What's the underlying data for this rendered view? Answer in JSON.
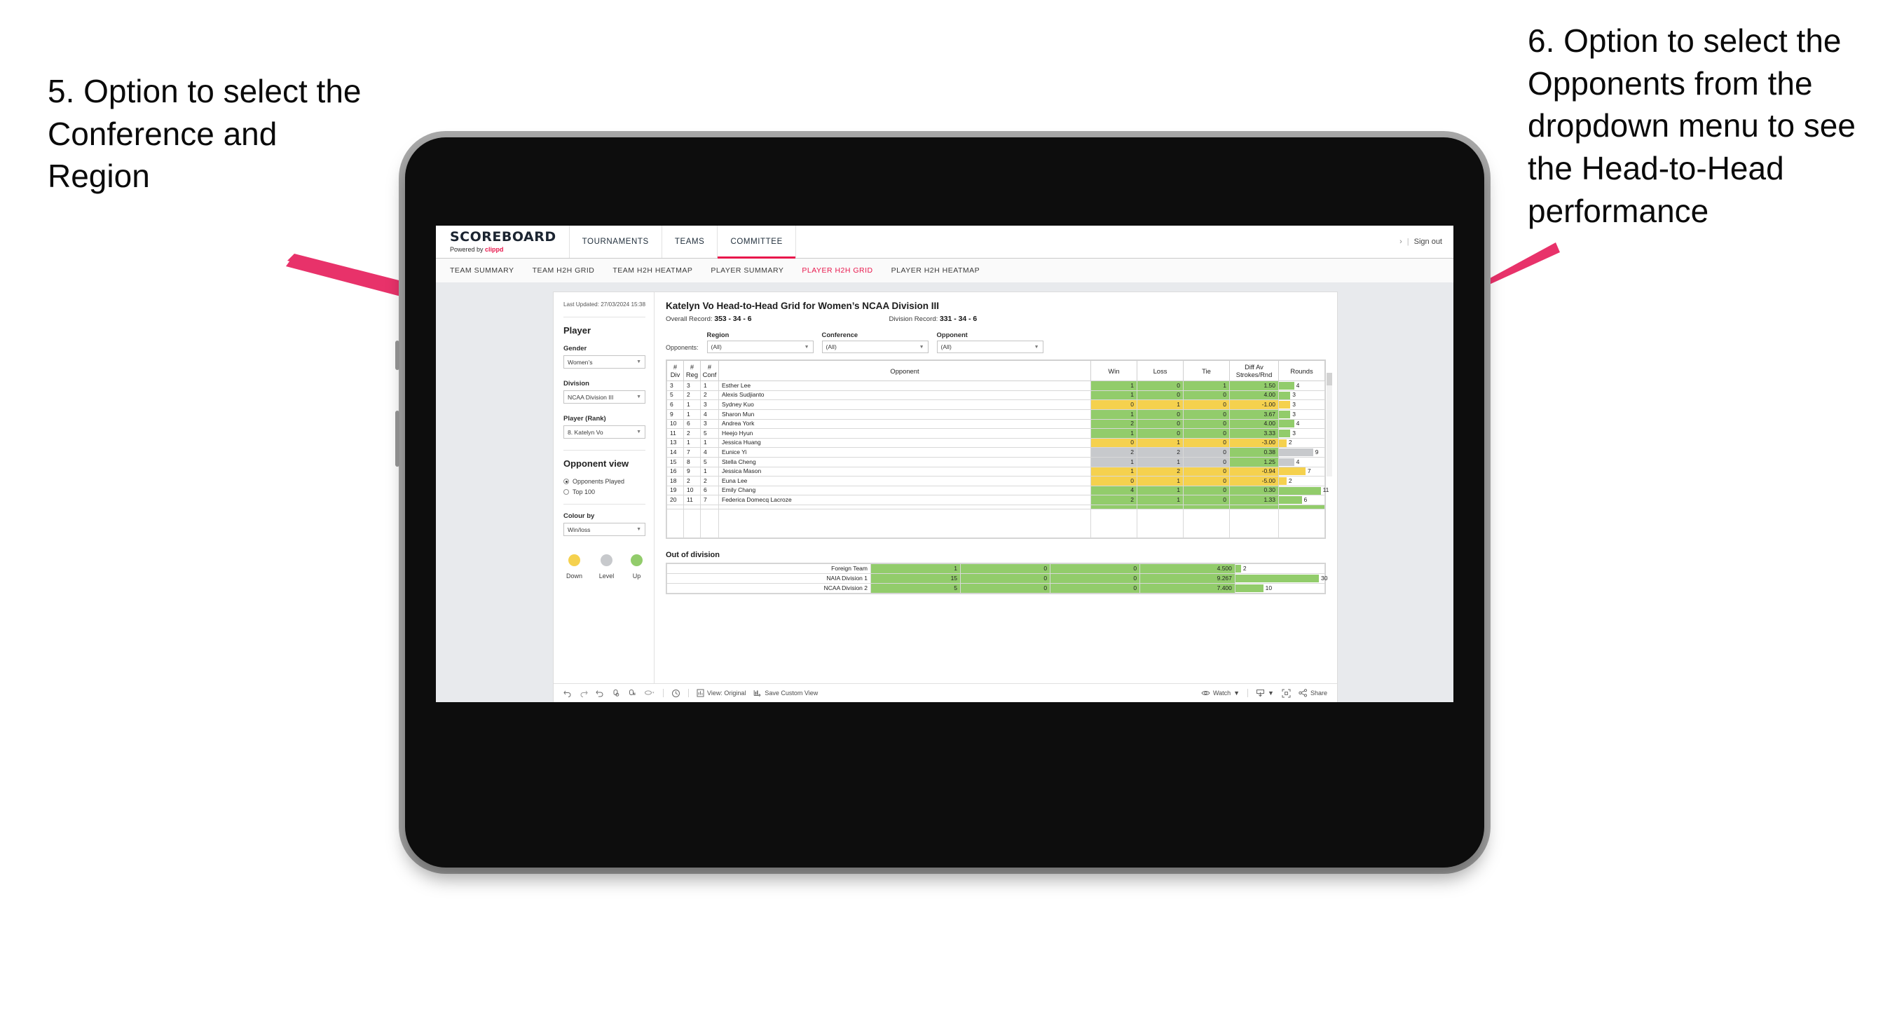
{
  "annotations": {
    "left": "5. Option to select the Conference and Region",
    "right": "6. Option to select the Opponents from the dropdown menu to see the Head-to-Head performance"
  },
  "colors": {
    "accent": "#e8174c",
    "up_green": "#92cc6b",
    "down_yellow": "#f5d14e",
    "level_grey": "#c7c9cc",
    "arrow": "#e8326a"
  },
  "app": {
    "brand": {
      "name": "SCOREBOARD",
      "powered_prefix": "Powered by",
      "powered_brand": "clippd"
    },
    "top_nav": [
      {
        "label": "TOURNAMENTS",
        "active": false
      },
      {
        "label": "TEAMS",
        "active": false
      },
      {
        "label": "COMMITTEE",
        "active": true
      }
    ],
    "top_right": {
      "chevron": "›",
      "divider": "|",
      "sign_out": "Sign out"
    },
    "sub_nav": [
      {
        "label": "TEAM SUMMARY",
        "active": false
      },
      {
        "label": "TEAM H2H GRID",
        "active": false
      },
      {
        "label": "TEAM H2H HEATMAP",
        "active": false
      },
      {
        "label": "PLAYER SUMMARY",
        "active": false
      },
      {
        "label": "PLAYER H2H GRID",
        "active": true
      },
      {
        "label": "PLAYER H2H HEATMAP",
        "active": false
      }
    ]
  },
  "sidebar": {
    "last_updated": "Last Updated: 27/03/2024 15:38",
    "section_player": "Player",
    "gender": {
      "label": "Gender",
      "value": "Women’s"
    },
    "division": {
      "label": "Division",
      "value": "NCAA Division III"
    },
    "player_rank": {
      "label": "Player (Rank)",
      "value": "8. Katelyn Vo"
    },
    "opponent_view": {
      "title": "Opponent view",
      "options": [
        {
          "label": "Opponents Played",
          "selected": true
        },
        {
          "label": "Top 100",
          "selected": false
        }
      ]
    },
    "colour_by": {
      "label": "Colour by",
      "value": "Win/loss"
    },
    "legend": [
      {
        "caption": "Down",
        "color": "#f5d14e"
      },
      {
        "caption": "Level",
        "color": "#c7c9cc"
      },
      {
        "caption": "Up",
        "color": "#92cc6b"
      }
    ]
  },
  "main": {
    "title": "Katelyn Vo Head-to-Head Grid for Women’s NCAA Division III",
    "overall_record": {
      "label": "Overall Record:",
      "value": "353 -  34 - 6"
    },
    "division_record": {
      "label": "Division Record:",
      "value": "331 -  34 - 6"
    },
    "filters_lead": "Opponents:",
    "filters": [
      {
        "label": "Region",
        "value": "(All)"
      },
      {
        "label": "Conference",
        "value": "(All)"
      },
      {
        "label": "Opponent",
        "value": "(All)"
      }
    ],
    "table": {
      "headers": [
        "# Div",
        "# Reg",
        "# Conf",
        "Opponent",
        "Win",
        "Loss",
        "Tie",
        "Diff Av Strokes/Rnd",
        "Rounds"
      ],
      "header_lines": [
        [
          "#",
          "Div"
        ],
        [
          "#",
          "Reg"
        ],
        [
          "#",
          "Conf"
        ],
        [
          "Opponent"
        ],
        [
          "Win"
        ],
        [
          "Loss"
        ],
        [
          "Tie"
        ],
        [
          "Diff Av",
          "Strokes/Rnd"
        ],
        [
          "Rounds"
        ]
      ],
      "rows": [
        {
          "div": "3",
          "reg": "3",
          "conf": "1",
          "opponent": "Esther Lee",
          "win": "1",
          "loss": "0",
          "tie": "1",
          "diff": "1.50",
          "rounds": "4",
          "state": "up"
        },
        {
          "div": "5",
          "reg": "2",
          "conf": "2",
          "opponent": "Alexis Sudjianto",
          "win": "1",
          "loss": "0",
          "tie": "0",
          "diff": "4.00",
          "rounds": "3",
          "state": "up"
        },
        {
          "div": "6",
          "reg": "1",
          "conf": "3",
          "opponent": "Sydney Kuo",
          "win": "0",
          "loss": "1",
          "tie": "0",
          "diff": "-1.00",
          "rounds": "3",
          "state": "down"
        },
        {
          "div": "9",
          "reg": "1",
          "conf": "4",
          "opponent": "Sharon Mun",
          "win": "1",
          "loss": "0",
          "tie": "0",
          "diff": "3.67",
          "rounds": "3",
          "state": "up"
        },
        {
          "div": "10",
          "reg": "6",
          "conf": "3",
          "opponent": "Andrea York",
          "win": "2",
          "loss": "0",
          "tie": "0",
          "diff": "4.00",
          "rounds": "4",
          "state": "up"
        },
        {
          "div": "11",
          "reg": "2",
          "conf": "5",
          "opponent": "Heejo Hyun",
          "win": "1",
          "loss": "0",
          "tie": "0",
          "diff": "3.33",
          "rounds": "3",
          "state": "up"
        },
        {
          "div": "13",
          "reg": "1",
          "conf": "1",
          "opponent": "Jessica Huang",
          "win": "0",
          "loss": "1",
          "tie": "0",
          "diff": "-3.00",
          "rounds": "2",
          "state": "down"
        },
        {
          "div": "14",
          "reg": "7",
          "conf": "4",
          "opponent": "Eunice Yi",
          "win": "2",
          "loss": "2",
          "tie": "0",
          "diff": "0.38",
          "rounds": "9",
          "state": "level"
        },
        {
          "div": "15",
          "reg": "8",
          "conf": "5",
          "opponent": "Stella Cheng",
          "win": "1",
          "loss": "1",
          "tie": "0",
          "diff": "1.25",
          "rounds": "4",
          "state": "level"
        },
        {
          "div": "16",
          "reg": "9",
          "conf": "1",
          "opponent": "Jessica Mason",
          "win": "1",
          "loss": "2",
          "tie": "0",
          "diff": "-0.94",
          "rounds": "7",
          "state": "down"
        },
        {
          "div": "18",
          "reg": "2",
          "conf": "2",
          "opponent": "Euna Lee",
          "win": "0",
          "loss": "1",
          "tie": "0",
          "diff": "-5.00",
          "rounds": "2",
          "state": "down"
        },
        {
          "div": "19",
          "reg": "10",
          "conf": "6",
          "opponent": "Emily Chang",
          "win": "4",
          "loss": "1",
          "tie": "0",
          "diff": "0.30",
          "rounds": "11",
          "state": "up"
        },
        {
          "div": "20",
          "reg": "11",
          "conf": "7",
          "opponent": "Federica Domecq Lacroze",
          "win": "2",
          "loss": "1",
          "tie": "0",
          "diff": "1.33",
          "rounds": "6",
          "state": "up"
        }
      ],
      "rounds_max": 12
    },
    "out_of_division": {
      "title": "Out of division",
      "rows": [
        {
          "name": "Foreign Team",
          "win": "1",
          "loss": "0",
          "tie": "0",
          "diff": "4.500",
          "rounds": "2",
          "state": "up"
        },
        {
          "name": "NAIA Division 1",
          "win": "15",
          "loss": "0",
          "tie": "0",
          "diff": "9.267",
          "rounds": "30",
          "state": "up"
        },
        {
          "name": "NCAA Division 2",
          "win": "5",
          "loss": "0",
          "tie": "0",
          "diff": "7.400",
          "rounds": "10",
          "state": "up"
        }
      ],
      "rounds_max": 32
    }
  },
  "toolbar": {
    "view_label": "View: Original",
    "save_label": "Save Custom View",
    "watch_label": "Watch",
    "share_label": "Share"
  }
}
